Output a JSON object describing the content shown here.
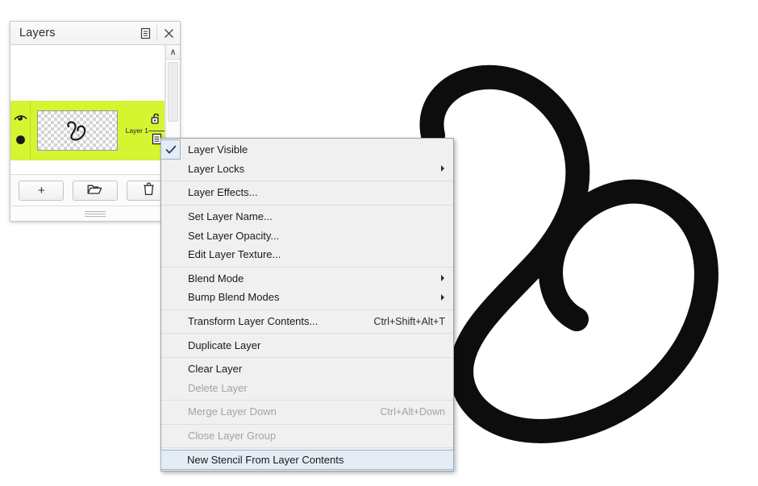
{
  "panel": {
    "title": "Layers",
    "titlebar_icons": [
      {
        "name": "panel-menu-icon",
        "glyph": "menu"
      },
      {
        "name": "close-icon",
        "glyph": "close"
      }
    ],
    "scrollbar": {
      "up_arrow": "∧"
    },
    "layer": {
      "name": "Layer 1",
      "visible_icon": "eye-icon",
      "alpha_icon": "filled-circle-icon",
      "lock_icon": "open-padlock-icon",
      "stack_icon": "layer-stack-icon",
      "thumbnail_alt": "swirl stroke on transparent checkerboard",
      "selected_color": "#d6f531"
    },
    "buttons": [
      {
        "name": "add-layer-button",
        "label": "+",
        "icon": "plus-icon"
      },
      {
        "name": "add-group-button",
        "label": "",
        "icon": "folder-icon"
      },
      {
        "name": "delete-layer-button",
        "label": "",
        "icon": "trash-icon"
      }
    ],
    "grip": "resize-grip"
  },
  "context_menu": {
    "items": [
      {
        "label": "Layer Visible",
        "checked": true,
        "disabled": false,
        "submenu": false,
        "shortcut": ""
      },
      {
        "label": "Layer Locks",
        "checked": false,
        "disabled": false,
        "submenu": true,
        "shortcut": ""
      },
      {
        "separator": true
      },
      {
        "label": "Layer Effects...",
        "checked": false,
        "disabled": false,
        "submenu": false,
        "shortcut": ""
      },
      {
        "separator": true
      },
      {
        "label": "Set Layer Name...",
        "checked": false,
        "disabled": false,
        "submenu": false,
        "shortcut": ""
      },
      {
        "label": "Set Layer Opacity...",
        "checked": false,
        "disabled": false,
        "submenu": false,
        "shortcut": ""
      },
      {
        "label": "Edit Layer Texture...",
        "checked": false,
        "disabled": false,
        "submenu": false,
        "shortcut": ""
      },
      {
        "separator": true
      },
      {
        "label": "Blend Mode",
        "checked": false,
        "disabled": false,
        "submenu": true,
        "shortcut": ""
      },
      {
        "label": "Bump Blend Modes",
        "checked": false,
        "disabled": false,
        "submenu": true,
        "shortcut": ""
      },
      {
        "separator": true
      },
      {
        "label": "Transform Layer Contents...",
        "checked": false,
        "disabled": false,
        "submenu": false,
        "shortcut": "Ctrl+Shift+Alt+T"
      },
      {
        "separator": true
      },
      {
        "label": "Duplicate Layer",
        "checked": false,
        "disabled": false,
        "submenu": false,
        "shortcut": ""
      },
      {
        "separator": true
      },
      {
        "label": "Clear Layer",
        "checked": false,
        "disabled": false,
        "submenu": false,
        "shortcut": ""
      },
      {
        "label": "Delete Layer",
        "checked": false,
        "disabled": true,
        "submenu": false,
        "shortcut": ""
      },
      {
        "separator": true
      },
      {
        "label": "Merge Layer Down",
        "checked": false,
        "disabled": true,
        "submenu": false,
        "shortcut": "Ctrl+Alt+Down"
      },
      {
        "separator": true
      },
      {
        "label": "Close Layer Group",
        "checked": false,
        "disabled": true,
        "submenu": false,
        "shortcut": ""
      },
      {
        "separator": true
      },
      {
        "label": "New Stencil From Layer Contents",
        "checked": false,
        "disabled": false,
        "submenu": false,
        "shortcut": "",
        "highlighted": true
      }
    ],
    "highlight_color": "#e4ecf5",
    "highlight_border_color": "#9cb4cc"
  },
  "canvas": {
    "artwork_name": "black-swirl-stroke",
    "stroke_color": "#0d0d0d",
    "background_color": "#ffffff"
  }
}
